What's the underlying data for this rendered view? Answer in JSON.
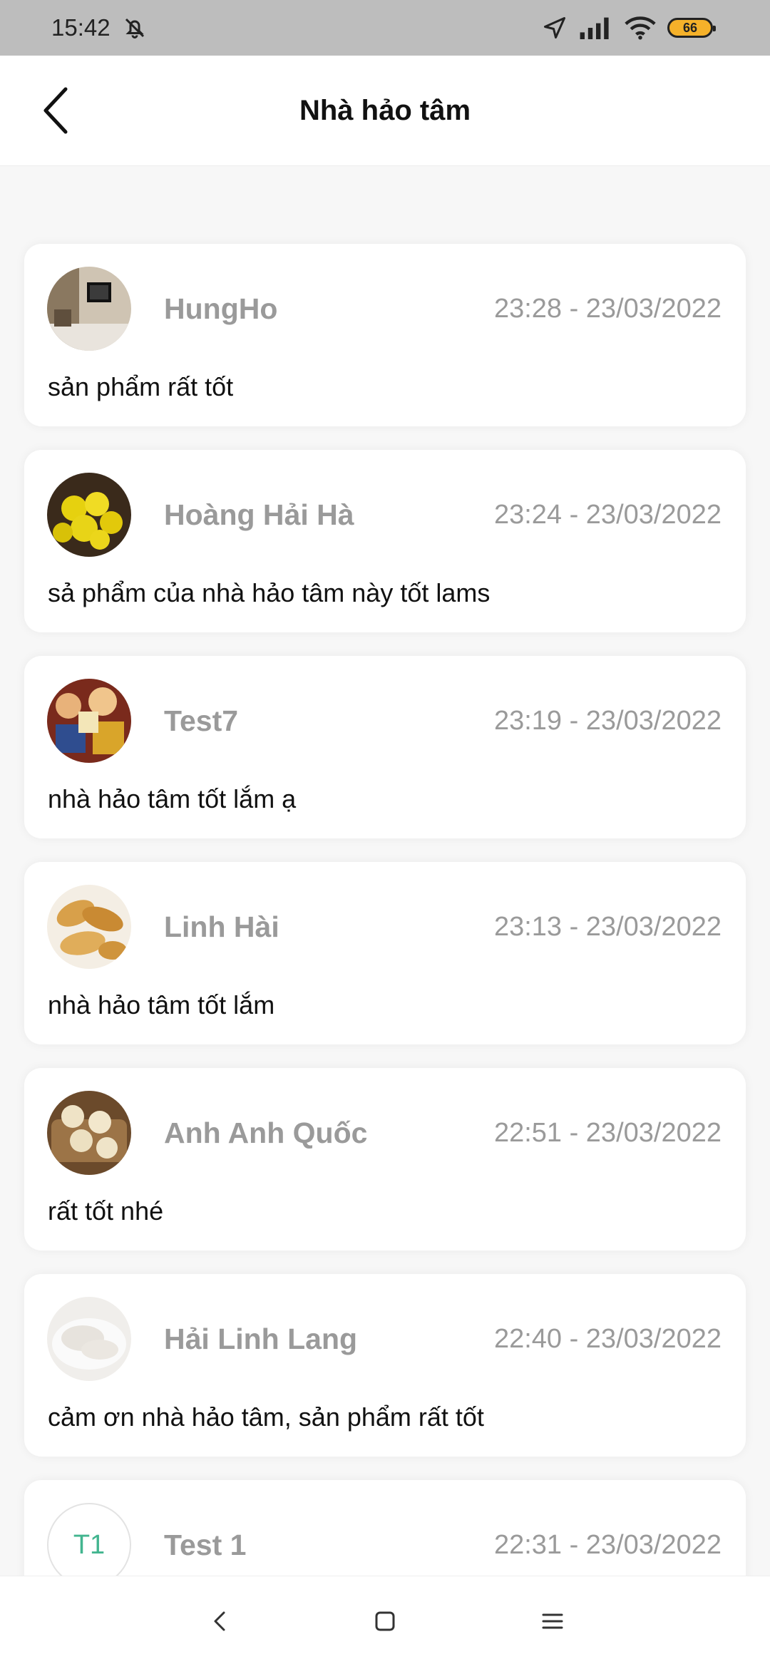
{
  "status_bar": {
    "time": "15:42",
    "battery": "66",
    "icons": [
      "muted-bell-icon",
      "location-arrow-icon",
      "signal-icon",
      "wifi-icon",
      "battery-icon"
    ]
  },
  "header": {
    "title": "Nhà hảo tâm",
    "back_icon": "chevron-left-icon"
  },
  "comments": [
    {
      "name": "HungHo",
      "time": "23:28 - 23/03/2022",
      "text": "sản phẩm rất tốt",
      "avatar": "room-photo"
    },
    {
      "name": "Hoàng Hải Hà",
      "time": "23:24 - 23/03/2022",
      "text": "sả phẩm của nhà hảo tâm này tốt lams",
      "avatar": "yellow-food-photo"
    },
    {
      "name": "Test7",
      "time": "23:19 - 23/03/2022",
      "text": "nhà hảo tâm tốt lắm ạ",
      "avatar": "anime-poster-photo"
    },
    {
      "name": "Linh Hài",
      "time": "23:13 - 23/03/2022",
      "text": "nhà hảo tâm tốt lắm",
      "avatar": "bread-photo"
    },
    {
      "name": "Anh Anh Quốc",
      "time": "22:51 - 23/03/2022",
      "text": "rất tốt nhé",
      "avatar": "dumplings-photo"
    },
    {
      "name": "Hải Linh Lang",
      "time": "22:40 - 23/03/2022",
      "text": "cảm ơn nhà hảo tâm, sản phẩm rất tốt",
      "avatar": "rice-photo"
    },
    {
      "name": "Test 1",
      "time": "22:31 - 23/03/2022",
      "text": "",
      "initials": "T1"
    }
  ],
  "nav": {
    "icons": [
      "back-nav-icon",
      "home-nav-icon",
      "recent-apps-icon"
    ]
  },
  "colors": {
    "status_bg": "#bdbdbd",
    "name_text": "#9a9a9a",
    "initials_text": "#42b58f",
    "battery_fill": "#f5b12a"
  }
}
